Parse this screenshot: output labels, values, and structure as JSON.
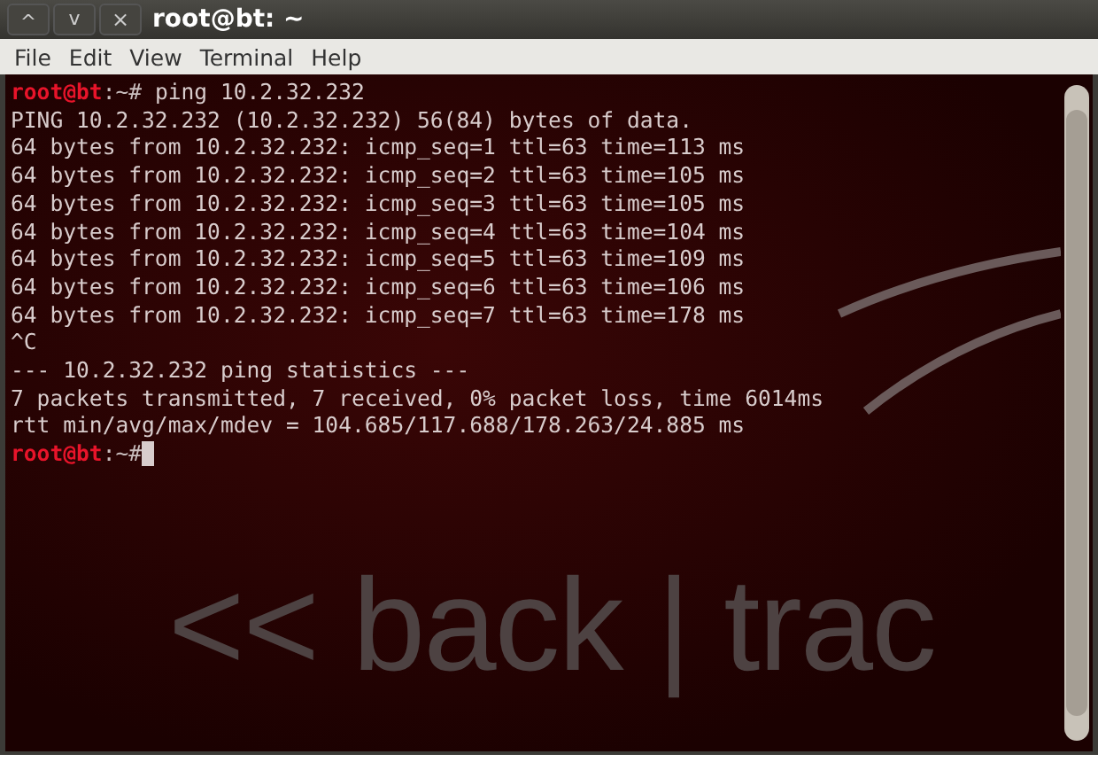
{
  "window": {
    "title": "root@bt: ~",
    "controls": [
      {
        "kind": "minimize",
        "glyph": "^"
      },
      {
        "kind": "maximize",
        "glyph": "v"
      },
      {
        "kind": "close",
        "glyph": "×"
      }
    ]
  },
  "menu": [
    "File",
    "Edit",
    "View",
    "Terminal",
    "Help"
  ],
  "terminal": {
    "lines": [
      {
        "kind": "prompt",
        "user": "root@bt",
        "path": ":~#",
        "command": " ping 10.2.32.232"
      },
      {
        "kind": "output",
        "text": "PING 10.2.32.232 (10.2.32.232) 56(84) bytes of data."
      },
      {
        "kind": "output",
        "text": "64 bytes from 10.2.32.232: icmp_seq=1 ttl=63 time=113 ms"
      },
      {
        "kind": "output",
        "text": "64 bytes from 10.2.32.232: icmp_seq=2 ttl=63 time=105 ms"
      },
      {
        "kind": "output",
        "text": "64 bytes from 10.2.32.232: icmp_seq=3 ttl=63 time=105 ms"
      },
      {
        "kind": "output",
        "text": "64 bytes from 10.2.32.232: icmp_seq=4 ttl=63 time=104 ms"
      },
      {
        "kind": "output",
        "text": "64 bytes from 10.2.32.232: icmp_seq=5 ttl=63 time=109 ms"
      },
      {
        "kind": "output",
        "text": "64 bytes from 10.2.32.232: icmp_seq=6 ttl=63 time=106 ms"
      },
      {
        "kind": "output",
        "text": "64 bytes from 10.2.32.232: icmp_seq=7 ttl=63 time=178 ms"
      },
      {
        "kind": "output",
        "text": "^C"
      },
      {
        "kind": "output",
        "text": "--- 10.2.32.232 ping statistics ---"
      },
      {
        "kind": "output",
        "text": "7 packets transmitted, 7 received, 0% packet loss, time 6014ms"
      },
      {
        "kind": "output",
        "text": "rtt min/avg/max/mdev = 104.685/117.688/178.263/24.885 ms"
      },
      {
        "kind": "prompt",
        "user": "root@bt",
        "path": ":~#",
        "cursor": true
      }
    ],
    "wallpaper_logo": "<< back | trac"
  }
}
